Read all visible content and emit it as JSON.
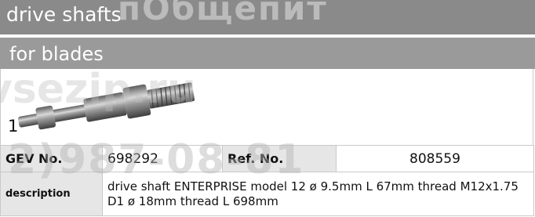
{
  "header": {
    "title": "drive shafts",
    "subtitle": "for blades"
  },
  "product": {
    "quantity": "1",
    "image_icon": "drive-shaft-image"
  },
  "table": {
    "gev_label": "GEV No.",
    "gev_value": "698292",
    "ref_label": "Ref. No.",
    "ref_value": "808559",
    "description_label": "description",
    "description_line1": "drive shaft  ENTERPRISE model 12 ø 9.5mm L 67mm thread M12x1.75",
    "description_line2": "D1 ø 18mm thread L 698mm"
  },
  "watermarks": {
    "top": "пОбщепит",
    "middle": "vsezip.ru",
    "bottom": "2)987-08-81"
  },
  "colors": {
    "header_bg": "#8a8a8a",
    "subheader_bg": "#9a9a9a",
    "label_bg": "#e6e6e6",
    "border": "#c9c9c9"
  }
}
